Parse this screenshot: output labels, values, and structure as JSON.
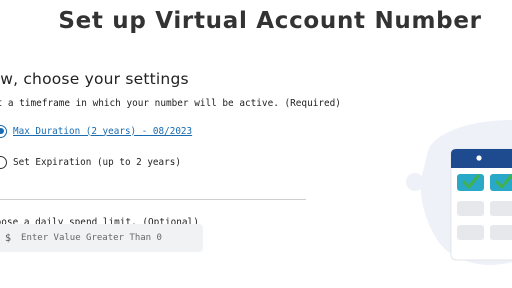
{
  "page": {
    "title": "Set up Virtual Account Number"
  },
  "settings": {
    "heading": "low, choose your settings",
    "timeframe_instruction": "et a timeframe in which your number will be active. (Required)",
    "options": [
      {
        "label": "Max Duration (2 years) - 08/2023",
        "selected": true
      },
      {
        "label": "Set Expiration (up to 2 years)",
        "selected": false
      }
    ]
  },
  "spend_limit": {
    "instruction": "hoose a daily spend limit. (Optional)",
    "currency_symbol": "$",
    "placeholder": "Enter Value Greater Than 0",
    "value": ""
  },
  "illustration": {
    "icon": "calendar-check-icon",
    "colors": {
      "header": "#1e4a8f",
      "check_tile": "#2aa8c7",
      "check_mark": "#3fb24f",
      "empty_tile": "#e6e8eb",
      "blob": "#eef2f8"
    }
  }
}
